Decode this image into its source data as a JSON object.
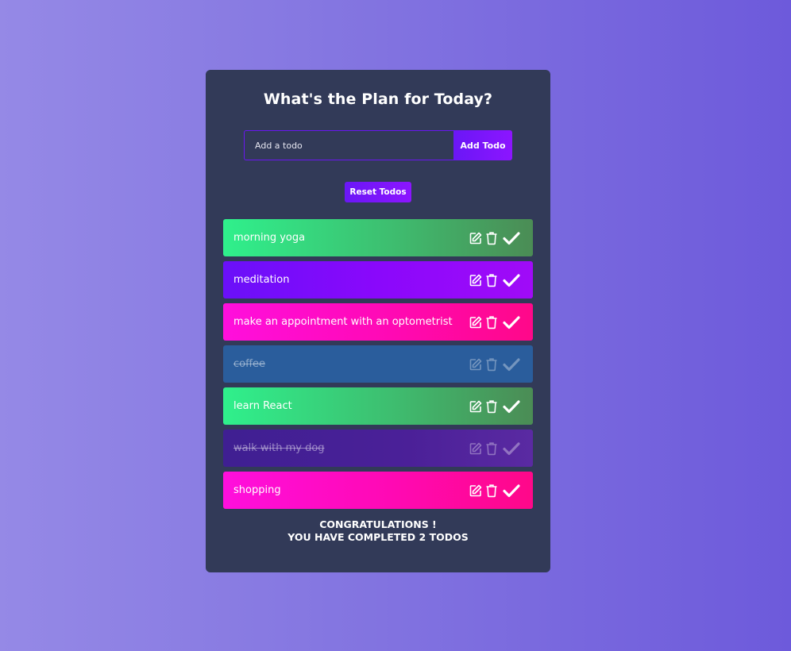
{
  "header": {
    "title": "What's the Plan for Today?"
  },
  "form": {
    "placeholder": "Add a todo",
    "value": "",
    "add_label": "Add Todo"
  },
  "reset_label": "Reset Todos",
  "todos": [
    {
      "text": "morning yoga",
      "completed": false,
      "color": "#2ff08c"
    },
    {
      "text": "meditation",
      "completed": false,
      "color": "#6a10f9"
    },
    {
      "text": "make an appointment with an optometrist",
      "completed": false,
      "color": "#ff0fdd"
    },
    {
      "text": "coffee",
      "completed": true,
      "color": "#2a5d9c"
    },
    {
      "text": "learn React",
      "completed": false,
      "color": "#2ff08c"
    },
    {
      "text": "walk with my dog",
      "completed": true,
      "color": "#3f1f92"
    },
    {
      "text": "shopping",
      "completed": false,
      "color": "#ff0fdd"
    }
  ],
  "todo_icons": [
    "edit-icon",
    "trash-icon",
    "check-icon"
  ],
  "footer": {
    "line1": "CONGRATULATIONS !",
    "line2": "YOU HAVE COMPLETED 2 TODOS"
  },
  "colors": {
    "card_bg": "#323a58",
    "accent": "#6a17f6"
  }
}
